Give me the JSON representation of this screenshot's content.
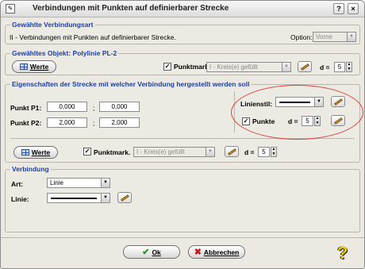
{
  "window": {
    "title": "Verbindungen mit Punkten auf definierbarer Strecke",
    "icon": "app-icon",
    "buttons": [
      "?",
      "×"
    ]
  },
  "art_group": {
    "title": "Gewählte Verbindungsart",
    "label": "II - Verbindungen mit Punkten auf definierbarer Strecke.",
    "option_label": "Option:",
    "option_value": "Vorne"
  },
  "object_group": {
    "title": "Gewähltes Objekt: Polylinie PL-2",
    "werte": "Werte",
    "punktmark": "Punktmark.",
    "mark_value": "I - Kreis(e) gefüllt",
    "d_label": "d =",
    "d_value": "5"
  },
  "props_group": {
    "title": "Eigenschaften der Strecke mit welcher Verbindung hergestellt werden soll",
    "p1_label": "Punkt P1:",
    "p1_x": "0,000",
    "p1_y": "0,000",
    "sep": ";",
    "p2_label": "Punkt P2:",
    "p2_x": "2,000",
    "p2_y": "2,000",
    "linienstil_label": "Linienstil:",
    "punkte_label": "Punkte",
    "d_label": "d =",
    "d_value": "5",
    "werte": "Werte",
    "punktmark": "Punktmark.",
    "mark_value": "I - Kreis(e) gefüllt",
    "d2_value": "5"
  },
  "conn_group": {
    "title": "Verbindung",
    "art_label": "Art:",
    "art_value": "Linie",
    "linie_label": "Linie:"
  },
  "footer": {
    "ok": "Ok",
    "cancel": "Abbrechen",
    "ok_icon": "checkmark-icon",
    "cancel_icon": "x-cancel-icon",
    "help_icon": "help-icon"
  }
}
